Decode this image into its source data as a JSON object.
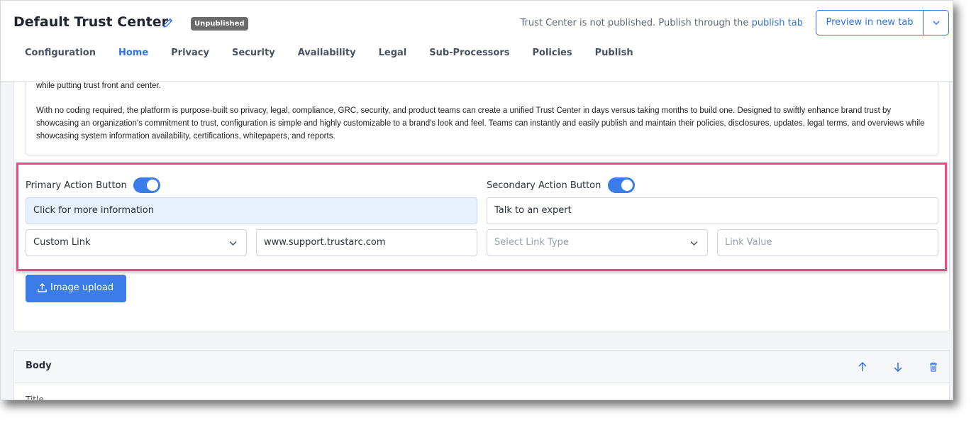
{
  "header": {
    "title": "Default Trust Center",
    "badge": "Unpublished",
    "notice_text": "Trust Center is not published. Publish through the",
    "notice_link": "publish tab",
    "preview_label": "Preview in new tab"
  },
  "tabs": [
    "Configuration",
    "Home",
    "Privacy",
    "Security",
    "Availability",
    "Legal",
    "Sub-Processors",
    "Policies",
    "Publish"
  ],
  "active_tab": "Home",
  "description": {
    "line_partial": "while putting trust front and center.",
    "paragraph": "With no coding required, the platform is purpose-built so privacy, legal, compliance, GRC, security, and product teams can create a unified Trust Center in days versus taking months to build one. Designed to swiftly enhance brand trust by showcasing an organization's commitment to trust, configuration is simple and highly customizable to a brand's look and feel. Teams can instantly and easily publish and maintain their policies, disclosures, updates, legal terms, and overviews while showcasing system information availability, certifications, whitepapers, and reports."
  },
  "primary": {
    "label": "Primary Action Button",
    "enabled": true,
    "text": "Click for more information",
    "link_type": "Custom Link",
    "link_value": "www.support.trustarc.com"
  },
  "secondary": {
    "label": "Secondary Action Button",
    "enabled": true,
    "text": "Talk to an expert",
    "link_type_placeholder": "Select Link Type",
    "link_value_placeholder": "Link Value"
  },
  "upload_label": "Image upload",
  "body_section": {
    "title": "Body",
    "field_label": "Title"
  },
  "colors": {
    "accent": "#2f72e0",
    "highlight_border": "#e94b86",
    "badge_bg": "#6b6b6b"
  }
}
